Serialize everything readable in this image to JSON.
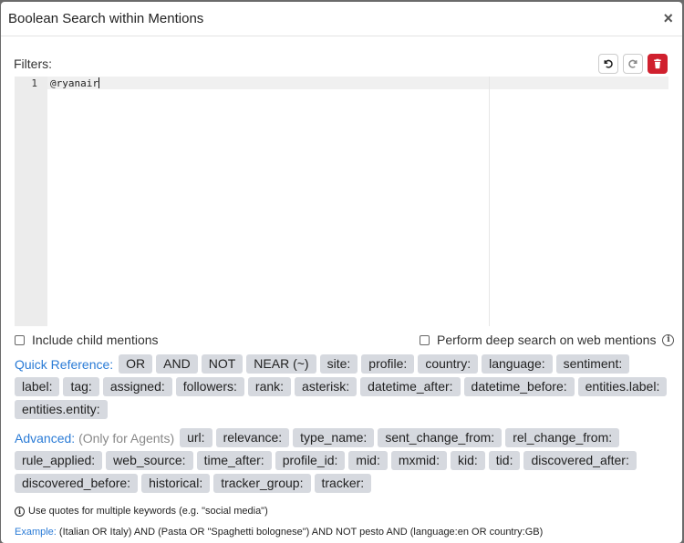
{
  "dialog": {
    "title": "Boolean Search within Mentions",
    "close_glyph": "×"
  },
  "filters": {
    "label": "Filters:"
  },
  "toolbar": {
    "undo_icon": "undo-icon",
    "redo_icon": "redo-icon",
    "delete_icon": "trash-icon",
    "delete_color": "#d0202e"
  },
  "editor": {
    "line_number": "1",
    "value": "@ryanair"
  },
  "options": {
    "include_child_label": "Include child mentions",
    "include_child_checked": false,
    "deep_search_label": "Perform deep search on web mentions",
    "deep_search_checked": false,
    "info_glyph": "i"
  },
  "quick_reference": {
    "title": "Quick Reference:",
    "items": [
      "OR",
      "AND",
      "NOT",
      "NEAR (~)",
      "site:",
      "profile:",
      "country:",
      "language:",
      "sentiment:",
      "label:",
      "tag:",
      "assigned:",
      "followers:",
      "rank:",
      "asterisk:",
      "datetime_after:",
      "datetime_before:",
      "entities.label:",
      "entities.entity:"
    ]
  },
  "advanced": {
    "title": "Advanced:",
    "note": "(Only for Agents)",
    "items": [
      "url:",
      "relevance:",
      "type_name:",
      "sent_change_from:",
      "rel_change_from:",
      "rule_applied:",
      "web_source:",
      "time_after:",
      "profile_id:",
      "mid:",
      "mxmid:",
      "kid:",
      "tid:",
      "discovered_after:",
      "discovered_before:",
      "historical:",
      "tracker_group:",
      "tracker:"
    ]
  },
  "footer": {
    "tip": "Use quotes for multiple keywords (e.g. \"social media\")",
    "example_label": "Example:",
    "example_text": "(Italian OR Italy) AND (Pasta OR \"Spaghetti bolognese\") AND NOT pesto AND (language:en OR country:GB)"
  },
  "colors": {
    "accent": "#2a7bd6",
    "tag_bg": "#d6d9df"
  }
}
